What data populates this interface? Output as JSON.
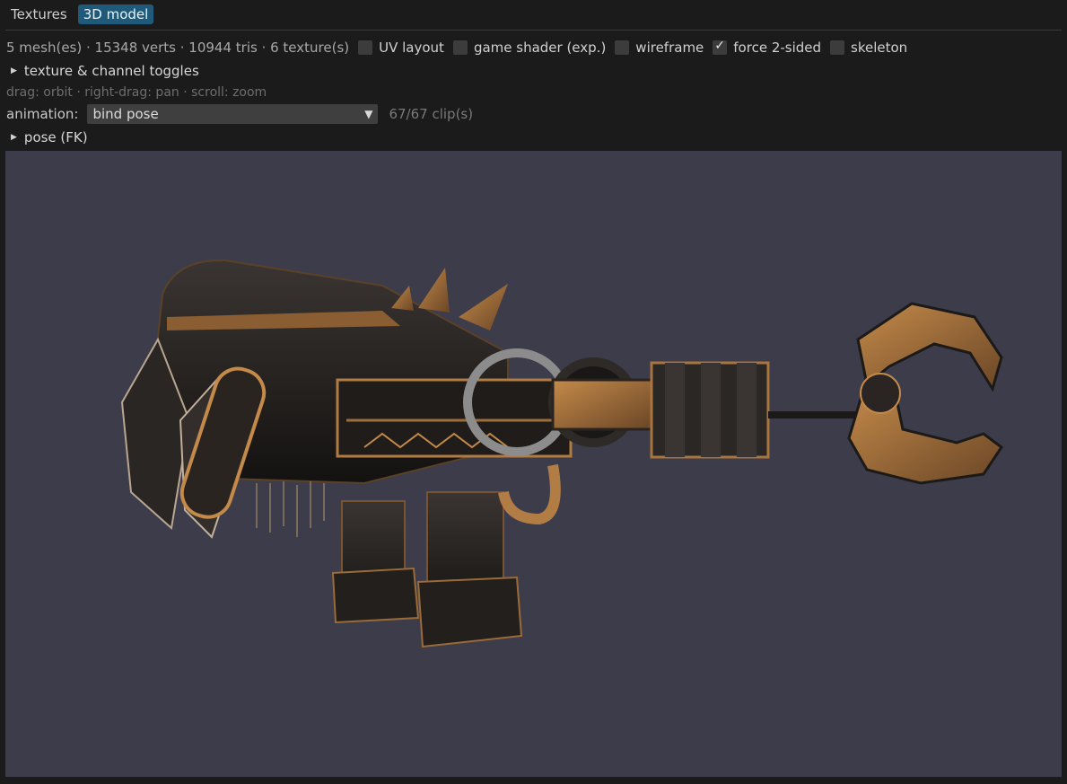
{
  "tabs": [
    {
      "label": "Textures",
      "active": false
    },
    {
      "label": "3D model",
      "active": true
    }
  ],
  "stats": "5 mesh(es) · 15348 verts · 10944 tris · 6 texture(s)",
  "options": {
    "uv_layout": {
      "label": "UV layout",
      "checked": false
    },
    "game_shader": {
      "label": "game shader (exp.)",
      "checked": false
    },
    "wireframe": {
      "label": "wireframe",
      "checked": false
    },
    "force_two_sided": {
      "label": "force 2-sided",
      "checked": true
    },
    "skeleton": {
      "label": "skeleton",
      "checked": false
    }
  },
  "texture_toggles": {
    "label": "texture & channel toggles",
    "expanded": false
  },
  "controls_hint": "drag: orbit · right-drag: pan · scroll: zoom",
  "animation": {
    "label": "animation:",
    "selected": "bind pose",
    "clip_count": "67/67 clip(s)"
  },
  "pose_fk": {
    "label": "pose (FK)",
    "expanded": false
  },
  "colors": {
    "accent": "#1f5a7a",
    "viewport_bg": "#3d3c4a",
    "metal_dark": "#1c1a19",
    "rust": "#a8753f"
  },
  "checkmark_glyph": "✓",
  "collapsed_glyph": "▶",
  "dropdown_glyph": "▼"
}
